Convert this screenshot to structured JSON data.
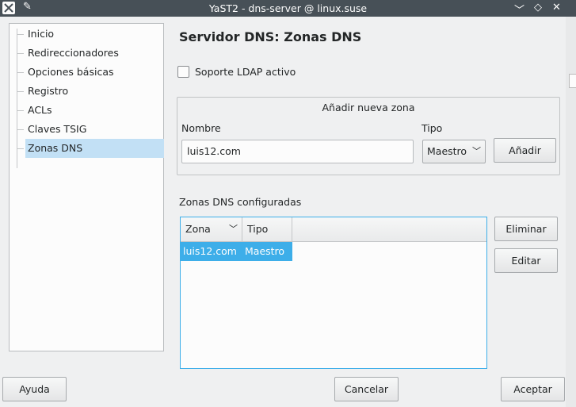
{
  "window": {
    "title": "YaST2 - dns-server @ linux.suse",
    "buttons": {
      "minimize": "﹀",
      "maximize": "◇",
      "close": "✕"
    }
  },
  "sidebar": {
    "items": [
      {
        "label": "Inicio"
      },
      {
        "label": "Redireccionadores"
      },
      {
        "label": "Opciones básicas"
      },
      {
        "label": "Registro"
      },
      {
        "label": "ACLs"
      },
      {
        "label": "Claves TSIG"
      },
      {
        "label": "Zonas DNS",
        "selected": true
      }
    ]
  },
  "main": {
    "heading": "Servidor DNS: Zonas DNS",
    "ldap_checkbox": {
      "label": "Soporte LDAP activo",
      "checked": false
    },
    "add_zone": {
      "title": "Añadir nueva zona",
      "name_label": "Nombre",
      "name_value": "luis12.com",
      "type_label": "Tipo",
      "type_value": "Maestro",
      "add_button": "Añadir"
    },
    "configured": {
      "label": "Zonas DNS configuradas",
      "columns": [
        "Zona",
        "Tipo"
      ],
      "rows": [
        {
          "zona": "luis12.com",
          "tipo": "Maestro",
          "selected": true
        }
      ],
      "delete_button": "Eliminar",
      "edit_button": "Editar"
    }
  },
  "footer": {
    "help_button": "Ayuda",
    "cancel_button": "Cancelar",
    "accept_button": "Aceptar"
  },
  "colors": {
    "accent": "#3daee9",
    "selection_light": "#c2e0f5",
    "titlebar": "#475057",
    "background": "#eff0f1"
  },
  "icons": {
    "app": "yast-icon",
    "pin": "pin-icon",
    "sort": "chevron-down-icon"
  }
}
